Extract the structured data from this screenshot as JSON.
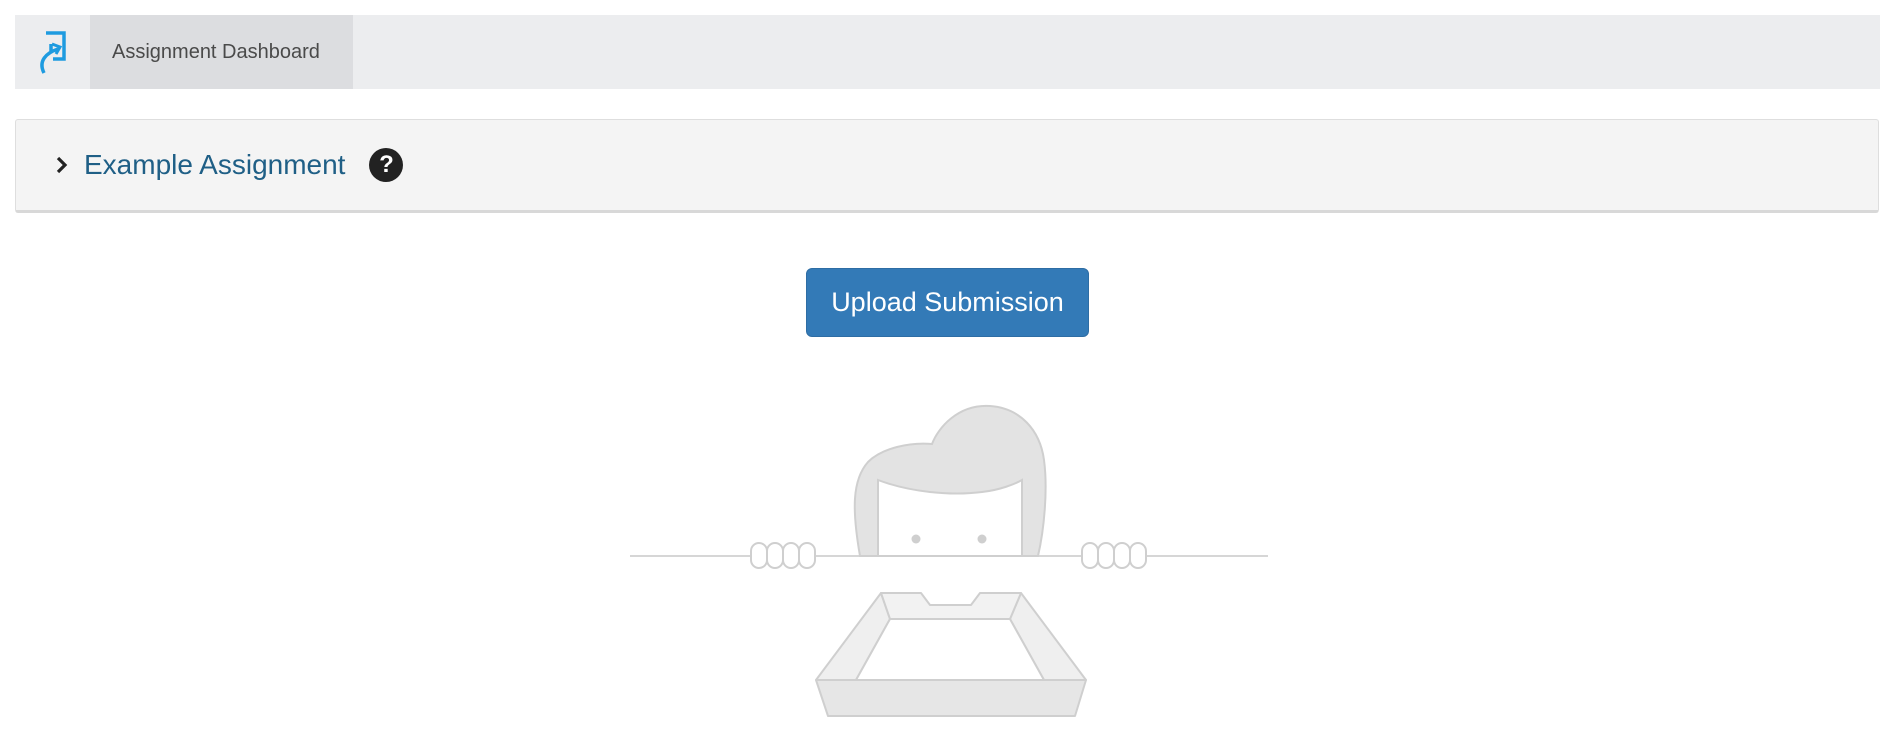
{
  "header": {
    "logo_icon": "return-arrow-logo-icon",
    "nav_tab_label": "Assignment Dashboard"
  },
  "assignment_panel": {
    "expand_icon": "chevron-right-icon",
    "title": "Example Assignment",
    "help_icon_glyph": "?"
  },
  "main": {
    "upload_button_label": "Upload Submission",
    "empty_state_illustration": "person-peeking-over-empty-tray"
  },
  "colors": {
    "accent_blue": "#337ab7",
    "link_blue": "#1f5f86",
    "logo_blue": "#1e9be0",
    "topbar_bg": "#ecedef",
    "panel_bg": "#f4f4f4"
  }
}
